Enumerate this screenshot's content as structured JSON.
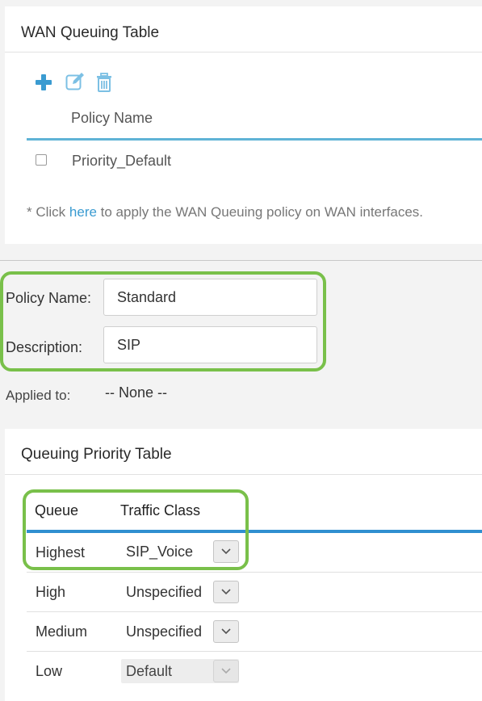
{
  "wan_table": {
    "title": "WAN Queuing Table",
    "column_header": "Policy Name",
    "rows": [
      {
        "policy_name": "Priority_Default",
        "checked": false
      }
    ],
    "note_prefix": "* Click ",
    "note_link": "here",
    "note_suffix": " to apply the WAN Queuing policy on WAN interfaces."
  },
  "toolbar": {
    "add_icon": "plus-icon",
    "edit_icon": "edit-icon",
    "delete_icon": "trash-icon",
    "accent": "#3a9bd1"
  },
  "form": {
    "policy_name_label": "Policy Name:",
    "policy_name_value": "Standard",
    "description_label": "Description:",
    "description_value": "SIP",
    "applied_to_label": "Applied to:",
    "applied_to_value": "-- None --"
  },
  "priority_table": {
    "title": "Queuing Priority Table",
    "col_queue": "Queue",
    "col_traffic_class": "Traffic Class",
    "rows": [
      {
        "queue": "Highest",
        "traffic_class": "SIP_Voice",
        "enabled": true
      },
      {
        "queue": "High",
        "traffic_class": "Unspecified",
        "enabled": true
      },
      {
        "queue": "Medium",
        "traffic_class": "Unspecified",
        "enabled": true
      },
      {
        "queue": "Low",
        "traffic_class": "Default",
        "enabled": false
      }
    ]
  },
  "colors": {
    "highlight": "#79c04a",
    "table_rule": "#5fb3d6",
    "link": "#3a9bd1"
  }
}
